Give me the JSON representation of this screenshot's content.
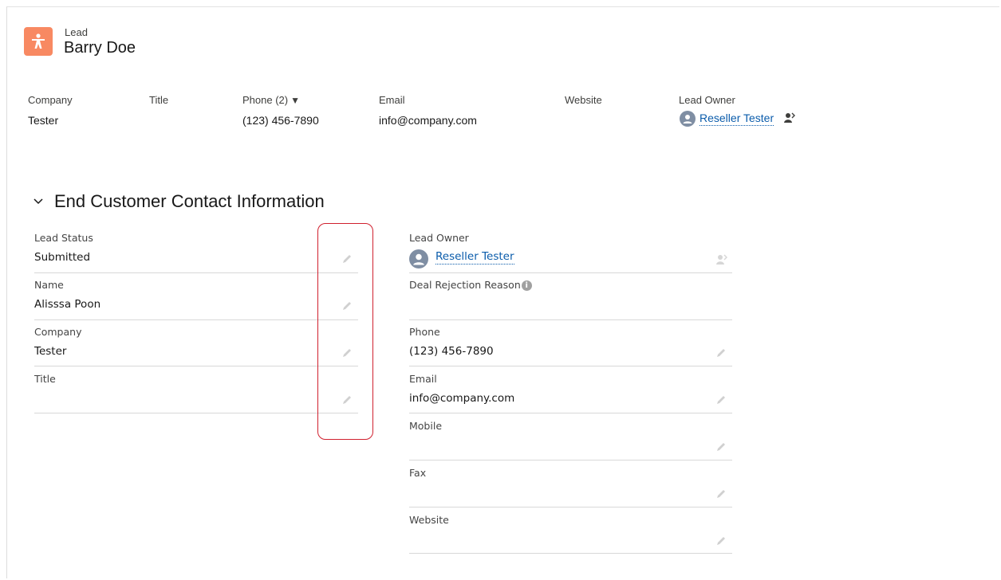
{
  "header": {
    "object_type": "Lead",
    "record_name": "Barry Doe"
  },
  "highlights": {
    "company": {
      "label": "Company",
      "value": "Tester"
    },
    "title": {
      "label": "Title",
      "value": ""
    },
    "phone": {
      "label": "Phone (2)",
      "caret": "▼",
      "value": "(123) 456-7890"
    },
    "email": {
      "label": "Email",
      "value": "info@company.com"
    },
    "website": {
      "label": "Website",
      "value": ""
    },
    "lead_owner": {
      "label": "Lead Owner",
      "value": "Reseller Tester"
    }
  },
  "section": {
    "title": "End Customer Contact Information",
    "left_fields": [
      {
        "label": "Lead Status",
        "value": "Submitted"
      },
      {
        "label": "Name",
        "value": "Alisssa Poon"
      },
      {
        "label": "Company",
        "value": "Tester"
      },
      {
        "label": "Title",
        "value": ""
      }
    ],
    "right_fields": [
      {
        "label": "Lead Owner",
        "value": "Reseller Tester"
      },
      {
        "label": "Deal Rejection Reason",
        "value": "",
        "info": "i"
      },
      {
        "label": "Phone",
        "value": "(123) 456-7890"
      },
      {
        "label": "Email",
        "value": "info@company.com"
      },
      {
        "label": "Mobile",
        "value": ""
      },
      {
        "label": "Fax",
        "value": ""
      },
      {
        "label": "Website",
        "value": ""
      }
    ]
  },
  "colors": {
    "lead_icon": "#f88962",
    "link": "#0b5cab",
    "highlight_box": "#d0202e"
  }
}
